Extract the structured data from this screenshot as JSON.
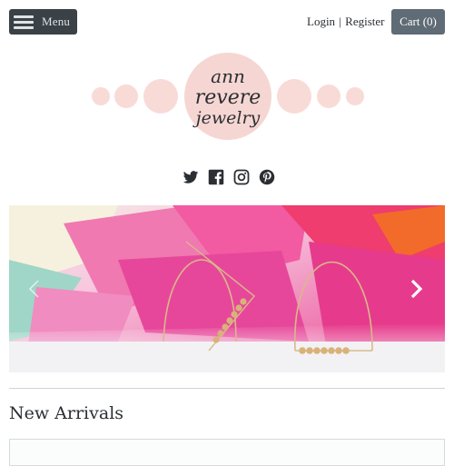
{
  "header": {
    "menu_label": "Menu",
    "login_label": "Login",
    "separator": "|",
    "register_label": "Register",
    "cart_label": "Cart (0)"
  },
  "logo": {
    "line1": "ann",
    "line2": "revere",
    "line3": "jewelry",
    "circle_color": "#f6d6d3",
    "dot_color": "#f8dbd7"
  },
  "social": [
    {
      "name": "twitter-icon"
    },
    {
      "name": "facebook-icon"
    },
    {
      "name": "instagram-icon"
    },
    {
      "name": "pinterest-icon"
    }
  ],
  "hero": {
    "prev_icon": "chevron-left-icon",
    "next_icon": "chevron-right-icon"
  },
  "section": {
    "title": "New Arrivals"
  },
  "colors": {
    "menu_bg": "#3a4147",
    "cart_bg": "#5f6b75",
    "text": "#2b2f33",
    "accent_pink": "#f6d6d3"
  }
}
